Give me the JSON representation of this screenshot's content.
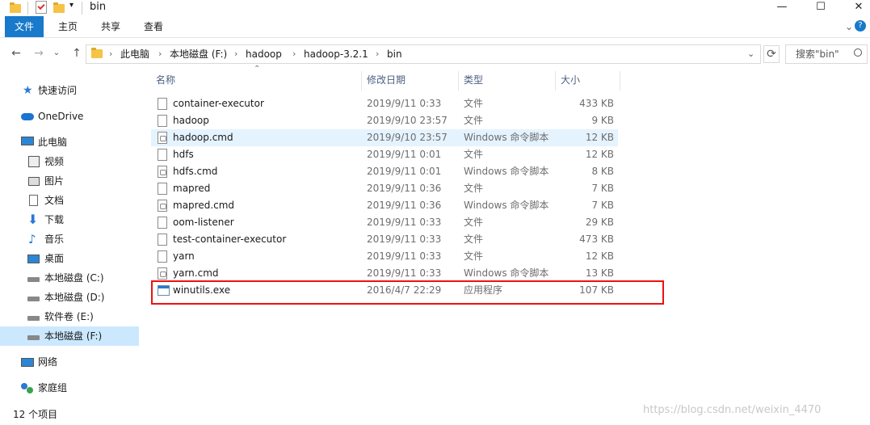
{
  "title": "bin",
  "window_buttons": {
    "minimize": "—",
    "maximize": "☐",
    "close": "✕"
  },
  "ribbon": {
    "tabs": [
      "文件",
      "主页",
      "共享",
      "查看"
    ],
    "expand": "⌄",
    "help": "?"
  },
  "nav": {
    "back": "←",
    "forward": "→",
    "recent": "⌄",
    "up": "↑",
    "refresh": "⟳"
  },
  "address": {
    "crumbs": [
      "此电脑",
      "本地磁盘 (F:)",
      "hadoop",
      "hadoop-3.2.1",
      "bin"
    ],
    "dropdown": "⌄"
  },
  "search": {
    "placeholder": "搜索\"bin\""
  },
  "sidebar": {
    "items": [
      {
        "label": "快速访问",
        "icon": "star-icon"
      },
      {
        "label": "OneDrive",
        "icon": "cloud-icon"
      },
      {
        "label": "此电脑",
        "icon": "computer-icon"
      },
      {
        "label": "视频",
        "icon": "video-icon"
      },
      {
        "label": "图片",
        "icon": "picture-icon"
      },
      {
        "label": "文档",
        "icon": "document-icon"
      },
      {
        "label": "下载",
        "icon": "download-icon"
      },
      {
        "label": "音乐",
        "icon": "music-icon"
      },
      {
        "label": "桌面",
        "icon": "desktop-icon"
      },
      {
        "label": "本地磁盘 (C:)",
        "icon": "drive-icon"
      },
      {
        "label": "本地磁盘 (D:)",
        "icon": "drive-icon"
      },
      {
        "label": "软件卷 (E:)",
        "icon": "drive-icon"
      },
      {
        "label": "本地磁盘 (F:)",
        "icon": "drive-icon"
      },
      {
        "label": "网络",
        "icon": "network-icon"
      },
      {
        "label": "家庭组",
        "icon": "homegroup-icon"
      }
    ]
  },
  "columns": {
    "name": "名称",
    "date": "修改日期",
    "type": "类型",
    "size": "大小",
    "sort_arrow": "⌃"
  },
  "files": [
    {
      "name": "container-executor",
      "date": "2019/9/11 0:33",
      "type": "文件",
      "size": "433 KB",
      "kind": "file"
    },
    {
      "name": "hadoop",
      "date": "2019/9/10 23:57",
      "type": "文件",
      "size": "9 KB",
      "kind": "file"
    },
    {
      "name": "hadoop.cmd",
      "date": "2019/9/10 23:57",
      "type": "Windows 命令脚本",
      "size": "12 KB",
      "kind": "cmd"
    },
    {
      "name": "hdfs",
      "date": "2019/9/11 0:01",
      "type": "文件",
      "size": "12 KB",
      "kind": "file"
    },
    {
      "name": "hdfs.cmd",
      "date": "2019/9/11 0:01",
      "type": "Windows 命令脚本",
      "size": "8 KB",
      "kind": "cmd"
    },
    {
      "name": "mapred",
      "date": "2019/9/11 0:36",
      "type": "文件",
      "size": "7 KB",
      "kind": "file"
    },
    {
      "name": "mapred.cmd",
      "date": "2019/9/11 0:36",
      "type": "Windows 命令脚本",
      "size": "7 KB",
      "kind": "cmd"
    },
    {
      "name": "oom-listener",
      "date": "2019/9/11 0:33",
      "type": "文件",
      "size": "29 KB",
      "kind": "file"
    },
    {
      "name": "test-container-executor",
      "date": "2019/9/11 0:33",
      "type": "文件",
      "size": "473 KB",
      "kind": "file"
    },
    {
      "name": "yarn",
      "date": "2019/9/11 0:33",
      "type": "文件",
      "size": "12 KB",
      "kind": "file"
    },
    {
      "name": "yarn.cmd",
      "date": "2019/9/11 0:33",
      "type": "Windows 命令脚本",
      "size": "13 KB",
      "kind": "cmd"
    },
    {
      "name": "winutils.exe",
      "date": "2016/4/7 22:29",
      "type": "应用程序",
      "size": "107 KB",
      "kind": "exe"
    }
  ],
  "status": "12 个项目",
  "watermark": "https://blog.csdn.net/weixin_4470",
  "colors": {
    "accent": "#1979ca",
    "highlight_box": "#ee1111",
    "selected": "#cce8ff"
  }
}
